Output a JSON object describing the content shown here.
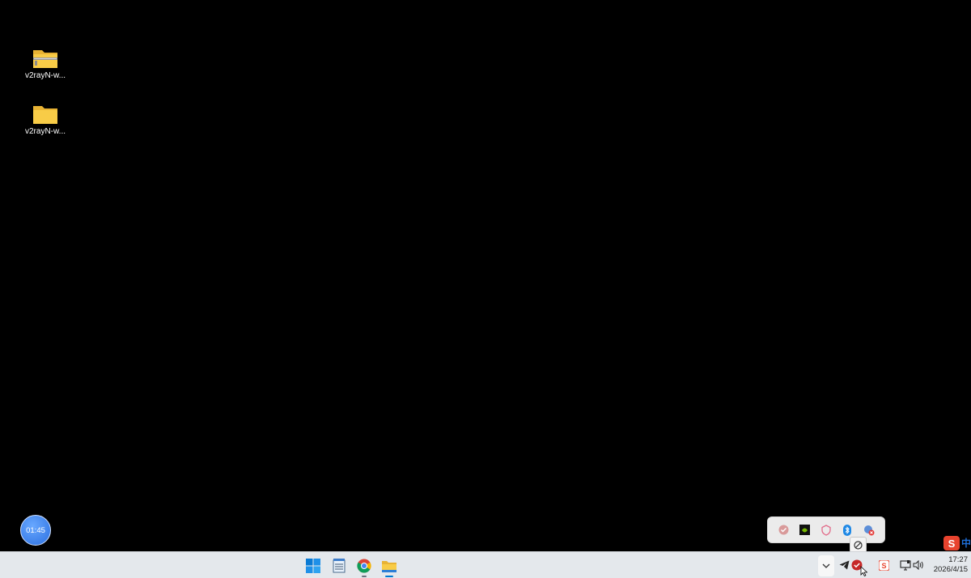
{
  "desktop": {
    "icons": [
      {
        "label": "v2rayN-w...",
        "type": "zip-folder"
      },
      {
        "label": "v2rayN-w...",
        "type": "folder"
      }
    ]
  },
  "timer_widget": {
    "time": "01:45"
  },
  "tray_overflow": {
    "icons": [
      "v2rayn-icon",
      "nvidia-icon",
      "security-icon",
      "bluetooth-icon",
      "app-disconnected-icon"
    ]
  },
  "ime": {
    "label": "中"
  },
  "taskbar": {
    "apps": [
      "start-button",
      "notepad-app",
      "chrome-app",
      "file-explorer-app"
    ],
    "clock": {
      "time": "17:27",
      "date": "2026/4/15"
    }
  },
  "colors": {
    "desktop_bg": "#000000",
    "taskbar_bg": "#e4e8ec",
    "accent_blue": "#0078d4",
    "folder_yellow": "#f8cc47"
  }
}
